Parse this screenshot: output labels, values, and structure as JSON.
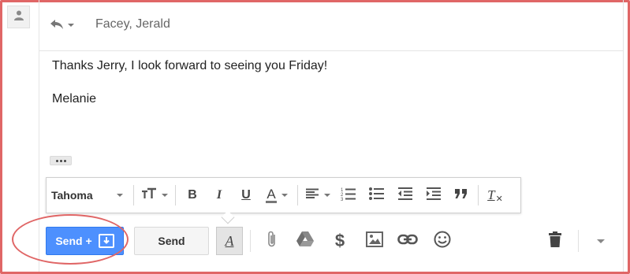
{
  "header": {
    "recipient": "Facey, Jerald"
  },
  "message": {
    "line1": "Thanks Jerry, I look forward to seeing you Friday!",
    "signature": "Melanie"
  },
  "formatting": {
    "font": "Tahoma",
    "bold_label": "B",
    "italic_label": "I",
    "underline_label": "U",
    "text_color_label": "A",
    "clear_label": "T"
  },
  "actions": {
    "send_plus_label": "Send +",
    "send_label": "Send",
    "format_toggle_label": "A",
    "money_label": "$"
  },
  "colors": {
    "primary_blue": "#4d90fe",
    "highlight_red": "#e06666",
    "text_color_underline": "#e06666"
  },
  "icons": [
    "person-icon",
    "reply-icon",
    "font-size-icon",
    "align-icon",
    "numbered-list-icon",
    "bulleted-list-icon",
    "indent-less-icon",
    "indent-more-icon",
    "quote-icon",
    "remove-formatting-icon",
    "send-archive-icon",
    "attach-icon",
    "drive-icon",
    "money-icon",
    "photo-icon",
    "link-icon",
    "emoji-icon",
    "trash-icon",
    "more-options-icon"
  ]
}
